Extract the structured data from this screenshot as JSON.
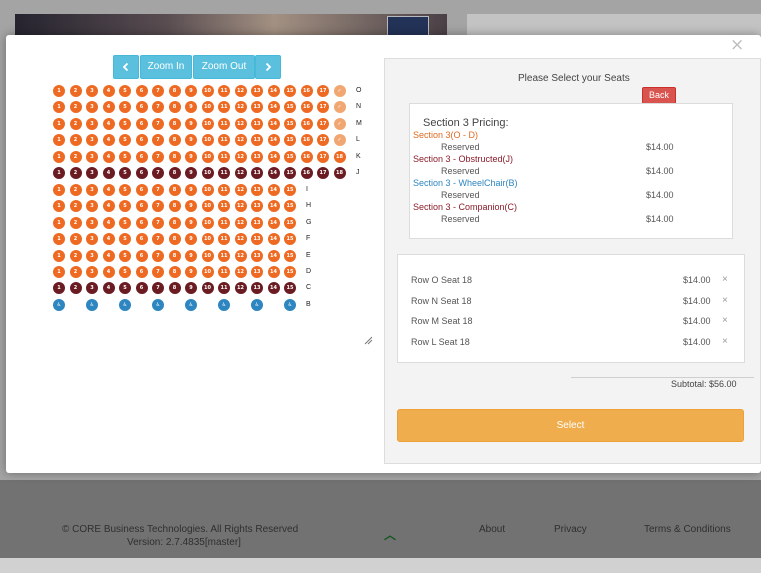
{
  "map_controls": {
    "prev_icon": "chevron-left-icon",
    "zoom_in": "Zoom In",
    "zoom_out": "Zoom Out",
    "next_icon": "chevron-right-icon"
  },
  "seating": {
    "rows": [
      {
        "label": "O",
        "seats": [
          "1",
          "2",
          "3",
          "4",
          "5",
          "6",
          "7",
          "8",
          "9",
          "10",
          "11",
          "12",
          "13",
          "14",
          "15",
          "16",
          "17",
          "✓"
        ],
        "types": [
          "o",
          "o",
          "o",
          "o",
          "o",
          "o",
          "o",
          "o",
          "o",
          "o",
          "o",
          "o",
          "o",
          "o",
          "o",
          "o",
          "o",
          "s"
        ]
      },
      {
        "label": "N",
        "seats": [
          "1",
          "2",
          "3",
          "4",
          "5",
          "6",
          "7",
          "8",
          "9",
          "10",
          "11",
          "12",
          "13",
          "14",
          "15",
          "16",
          "17",
          "✓"
        ],
        "types": [
          "o",
          "o",
          "o",
          "o",
          "o",
          "o",
          "o",
          "o",
          "o",
          "o",
          "o",
          "o",
          "o",
          "o",
          "o",
          "o",
          "o",
          "s"
        ]
      },
      {
        "label": "M",
        "seats": [
          "1",
          "2",
          "3",
          "4",
          "5",
          "6",
          "7",
          "8",
          "9",
          "10",
          "11",
          "12",
          "13",
          "14",
          "15",
          "16",
          "17",
          "✓"
        ],
        "types": [
          "o",
          "o",
          "o",
          "o",
          "o",
          "o",
          "o",
          "o",
          "o",
          "o",
          "o",
          "o",
          "o",
          "o",
          "o",
          "o",
          "o",
          "s"
        ]
      },
      {
        "label": "L",
        "seats": [
          "1",
          "2",
          "3",
          "4",
          "5",
          "6",
          "7",
          "8",
          "9",
          "10",
          "11",
          "12",
          "13",
          "14",
          "15",
          "16",
          "17",
          "✓"
        ],
        "types": [
          "o",
          "o",
          "o",
          "o",
          "o",
          "o",
          "o",
          "o",
          "o",
          "o",
          "o",
          "o",
          "o",
          "o",
          "o",
          "o",
          "o",
          "s"
        ]
      },
      {
        "label": "K",
        "seats": [
          "1",
          "2",
          "3",
          "4",
          "5",
          "6",
          "7",
          "8",
          "9",
          "10",
          "11",
          "12",
          "13",
          "14",
          "15",
          "16",
          "17",
          "18"
        ],
        "types": [
          "o",
          "o",
          "o",
          "o",
          "o",
          "o",
          "o",
          "o",
          "o",
          "o",
          "o",
          "o",
          "o",
          "o",
          "o",
          "o",
          "o",
          "o"
        ]
      },
      {
        "label": "J",
        "seats": [
          "1",
          "2",
          "3",
          "4",
          "5",
          "6",
          "7",
          "8",
          "9",
          "10",
          "11",
          "12",
          "13",
          "14",
          "15",
          "16",
          "17",
          "18"
        ],
        "types": [
          "m",
          "m",
          "m",
          "m",
          "m",
          "m",
          "m",
          "m",
          "m",
          "m",
          "m",
          "m",
          "m",
          "m",
          "m",
          "m",
          "m",
          "m"
        ]
      },
      {
        "label": "I",
        "seats": [
          "1",
          "2",
          "3",
          "4",
          "5",
          "6",
          "7",
          "8",
          "9",
          "10",
          "11",
          "12",
          "13",
          "14",
          "15"
        ],
        "types": [
          "o",
          "o",
          "o",
          "o",
          "o",
          "o",
          "o",
          "o",
          "o",
          "o",
          "o",
          "o",
          "o",
          "o",
          "o"
        ]
      },
      {
        "label": "H",
        "seats": [
          "1",
          "2",
          "3",
          "4",
          "5",
          "6",
          "7",
          "8",
          "9",
          "10",
          "11",
          "12",
          "13",
          "14",
          "15"
        ],
        "types": [
          "o",
          "o",
          "o",
          "o",
          "o",
          "o",
          "o",
          "o",
          "o",
          "o",
          "o",
          "o",
          "o",
          "o",
          "o"
        ]
      },
      {
        "label": "G",
        "seats": [
          "1",
          "2",
          "3",
          "4",
          "5",
          "6",
          "7",
          "8",
          "9",
          "10",
          "11",
          "12",
          "13",
          "14",
          "15"
        ],
        "types": [
          "o",
          "o",
          "o",
          "o",
          "o",
          "o",
          "o",
          "o",
          "o",
          "o",
          "o",
          "o",
          "o",
          "o",
          "o"
        ]
      },
      {
        "label": "F",
        "seats": [
          "1",
          "2",
          "3",
          "4",
          "5",
          "6",
          "7",
          "8",
          "9",
          "10",
          "11",
          "12",
          "13",
          "14",
          "15"
        ],
        "types": [
          "o",
          "o",
          "o",
          "o",
          "o",
          "o",
          "o",
          "o",
          "o",
          "o",
          "o",
          "o",
          "o",
          "o",
          "o"
        ]
      },
      {
        "label": "E",
        "seats": [
          "1",
          "2",
          "3",
          "4",
          "5",
          "6",
          "7",
          "8",
          "9",
          "10",
          "11",
          "12",
          "13",
          "14",
          "15"
        ],
        "types": [
          "o",
          "o",
          "o",
          "o",
          "o",
          "o",
          "o",
          "o",
          "o",
          "o",
          "o",
          "o",
          "o",
          "o",
          "o"
        ]
      },
      {
        "label": "D",
        "seats": [
          "1",
          "2",
          "3",
          "4",
          "5",
          "6",
          "7",
          "8",
          "9",
          "10",
          "11",
          "12",
          "13",
          "14",
          "15"
        ],
        "types": [
          "o",
          "o",
          "o",
          "o",
          "o",
          "o",
          "o",
          "o",
          "o",
          "o",
          "o",
          "o",
          "o",
          "o",
          "o"
        ]
      },
      {
        "label": "C",
        "seats": [
          "1",
          "2",
          "3",
          "4",
          "5",
          "6",
          "7",
          "8",
          "9",
          "10",
          "11",
          "12",
          "13",
          "14",
          "15"
        ],
        "types": [
          "m",
          "m",
          "m",
          "m",
          "m",
          "m",
          "m",
          "m",
          "m",
          "m",
          "m",
          "m",
          "m",
          "m",
          "m"
        ]
      },
      {
        "label": "B",
        "seats": [
          "♿",
          "♿",
          "♿",
          "♿",
          "♿",
          "♿",
          "♿",
          "♿"
        ],
        "types": [
          "b",
          "b",
          "b",
          "b",
          "b",
          "b",
          "b",
          "b"
        ]
      }
    ],
    "colors": {
      "available": "#ee6a23",
      "obstructed_companion": "#6b1c22",
      "wheelchair": "#2e86c1",
      "selected": "#f1a772"
    }
  },
  "panel": {
    "title": "Please Select your Seats",
    "back_label": "Back",
    "pricing_title": "Section 3 Pricing:",
    "pricing": [
      {
        "name": "Section 3(O - D)",
        "type": "Reserved",
        "price": "$14.00",
        "color": "#e06a1f"
      },
      {
        "name": "Section 3 - Obstructed(J)",
        "type": "Reserved",
        "price": "$14.00",
        "color": "#8b1c2a"
      },
      {
        "name": "Section 3 - WheelChair(B)",
        "type": "Reserved",
        "price": "$14.00",
        "color": "#2e86c1"
      },
      {
        "name": "Section 3 - Companion(C)",
        "type": "Reserved",
        "price": "$14.00",
        "color": "#8b1c2a"
      }
    ],
    "cart": [
      {
        "label": "Row O Seat 18",
        "price": "$14.00"
      },
      {
        "label": "Row N Seat 18",
        "price": "$14.00"
      },
      {
        "label": "Row M Seat 18",
        "price": "$14.00"
      },
      {
        "label": "Row L Seat 18",
        "price": "$14.00"
      }
    ],
    "remove_icon": "close-icon",
    "subtotal": "Subtotal: $56.00",
    "select_label": "Select"
  },
  "footer": {
    "copyright": "© CORE Business Technologies. All Rights Reserved",
    "version": "Version: 2.7.4835[master]",
    "about": "About",
    "privacy": "Privacy",
    "terms": "Terms & Conditions"
  }
}
